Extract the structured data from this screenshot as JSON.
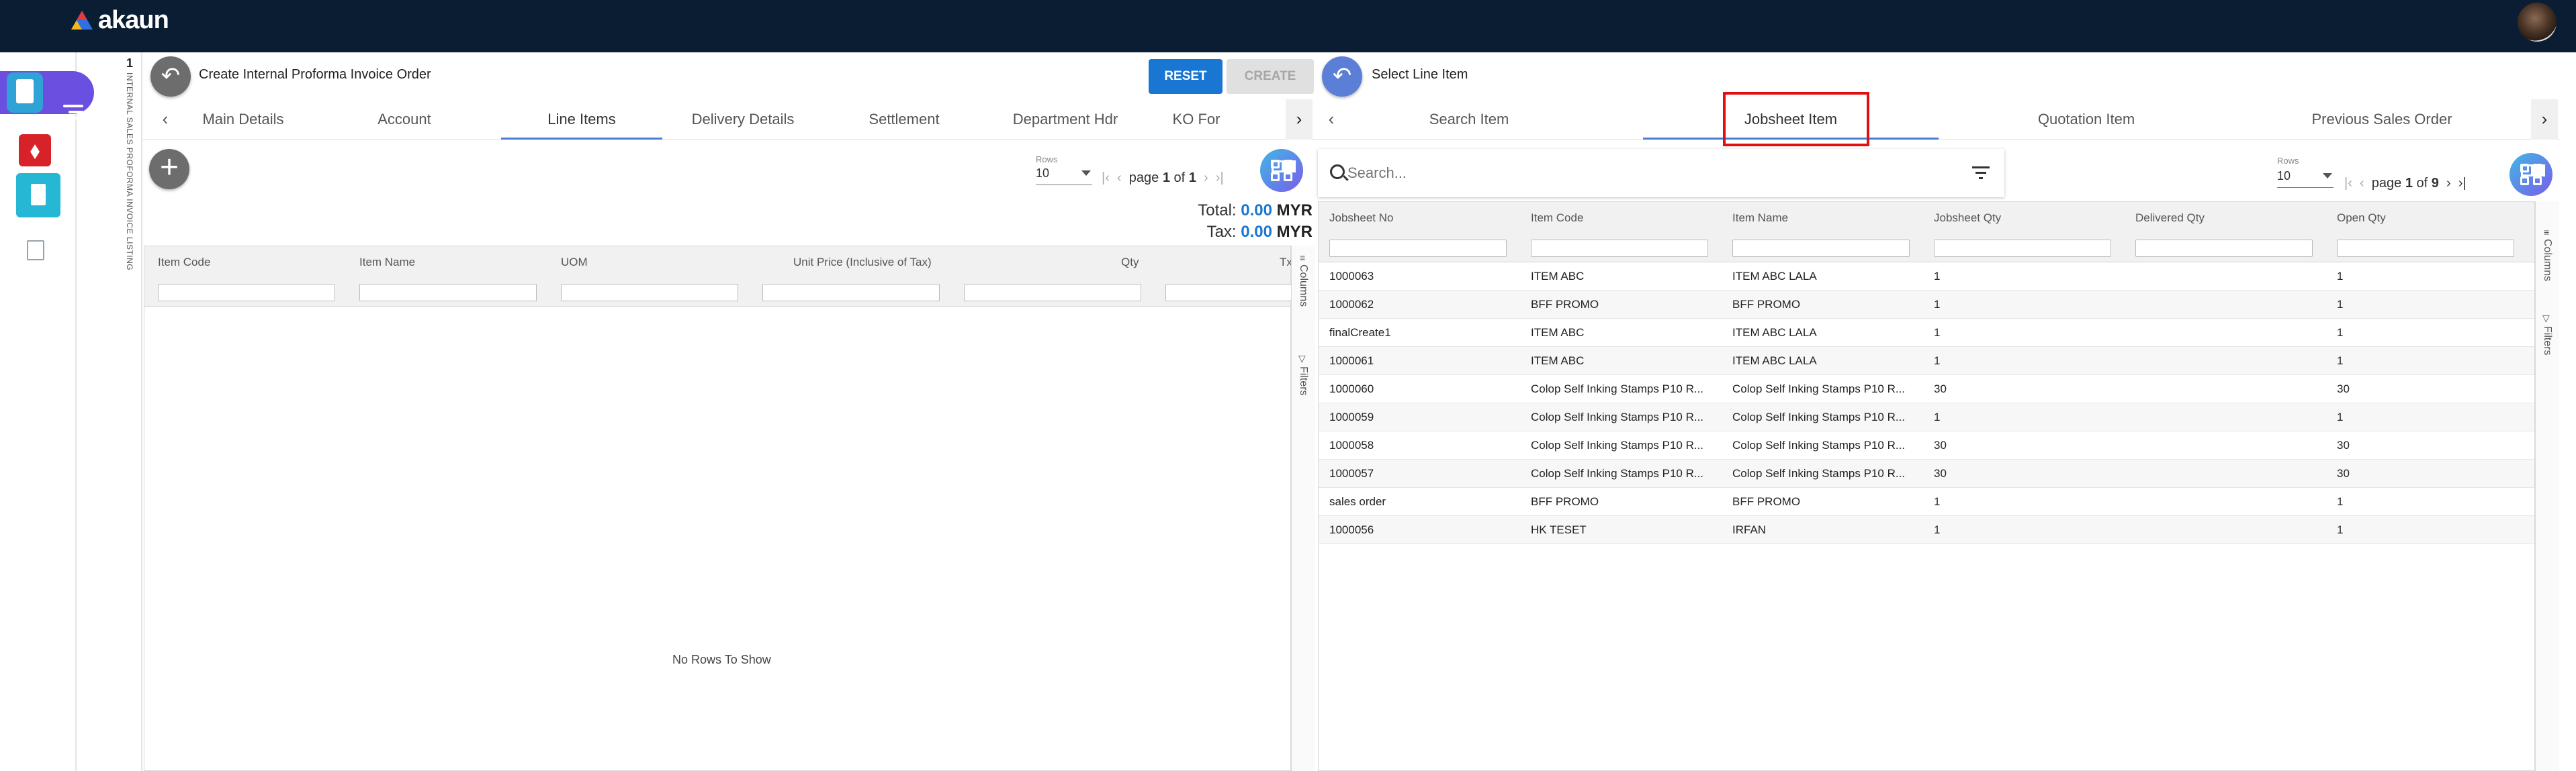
{
  "app": {
    "logo_text": "akaun"
  },
  "rail": {
    "number": "1",
    "label": "INTERNAL SALES PROFORMA INVOICE LISTING"
  },
  "left": {
    "title": "Create Internal Proforma Invoice Order",
    "reset_label": "RESET",
    "create_label": "CREATE",
    "tabs": [
      "Main Details",
      "Account",
      "Line Items",
      "Delivery Details",
      "Settlement",
      "Department Hdr",
      "KO For"
    ],
    "active_tab": "Line Items",
    "rows_label": "Rows",
    "rows_value": "10",
    "page_text": "page",
    "page_num": "1",
    "of_text": "of",
    "page_total": "1",
    "total_label": "Total:",
    "total_value": "0.00",
    "tax_label": "Tax:",
    "tax_value": "0.00",
    "currency": "MYR",
    "columns": [
      "Item Code",
      "Item Name",
      "UOM",
      "Unit Price (Inclusive of Tax)",
      "Qty",
      "Tx"
    ],
    "empty_text": "No Rows To Show",
    "tool_columns": "Columns",
    "tool_filters": "Filters"
  },
  "right": {
    "title": "Select Line Item",
    "tabs": [
      "Search Item",
      "Jobsheet Item",
      "Quotation Item",
      "Previous Sales Order"
    ],
    "active_tab": "Jobsheet Item",
    "search_placeholder": "Search...",
    "rows_label": "Rows",
    "rows_value": "10",
    "page_text": "page",
    "page_num": "1",
    "of_text": "of",
    "page_total": "9",
    "columns": [
      "Jobsheet No",
      "Item Code",
      "Item Name",
      "Jobsheet Qty",
      "Delivered Qty",
      "Open Qty"
    ],
    "rows": [
      [
        "1000063",
        "ITEM ABC",
        "ITEM ABC LALA",
        "1",
        "",
        "1"
      ],
      [
        "1000062",
        "BFF PROMO",
        "BFF PROMO",
        "1",
        "",
        "1"
      ],
      [
        "finalCreate1",
        "ITEM ABC",
        "ITEM ABC LALA",
        "1",
        "",
        "1"
      ],
      [
        "1000061",
        "ITEM ABC",
        "ITEM ABC LALA",
        "1",
        "",
        "1"
      ],
      [
        "1000060",
        "Colop Self Inking Stamps P10 R...",
        "Colop Self Inking Stamps P10 R...",
        "30",
        "",
        "30"
      ],
      [
        "1000059",
        "Colop Self Inking Stamps P10 R...",
        "Colop Self Inking Stamps P10 R...",
        "1",
        "",
        "1"
      ],
      [
        "1000058",
        "Colop Self Inking Stamps P10 R...",
        "Colop Self Inking Stamps P10 R...",
        "30",
        "",
        "30"
      ],
      [
        "1000057",
        "Colop Self Inking Stamps P10 R...",
        "Colop Self Inking Stamps P10 R...",
        "30",
        "",
        "30"
      ],
      [
        "sales order",
        "BFF PROMO",
        "BFF PROMO",
        "1",
        "",
        "1"
      ],
      [
        "1000056",
        "HK TESET",
        "IRFAN",
        "1",
        "",
        "1"
      ]
    ],
    "tool_columns": "Columns",
    "tool_filters": "Filters"
  },
  "colors": {
    "topbar": "#0b1d33",
    "accent": "#1976d2",
    "highlight": "#e01010",
    "sidebar_active": "#6b4fe0"
  }
}
